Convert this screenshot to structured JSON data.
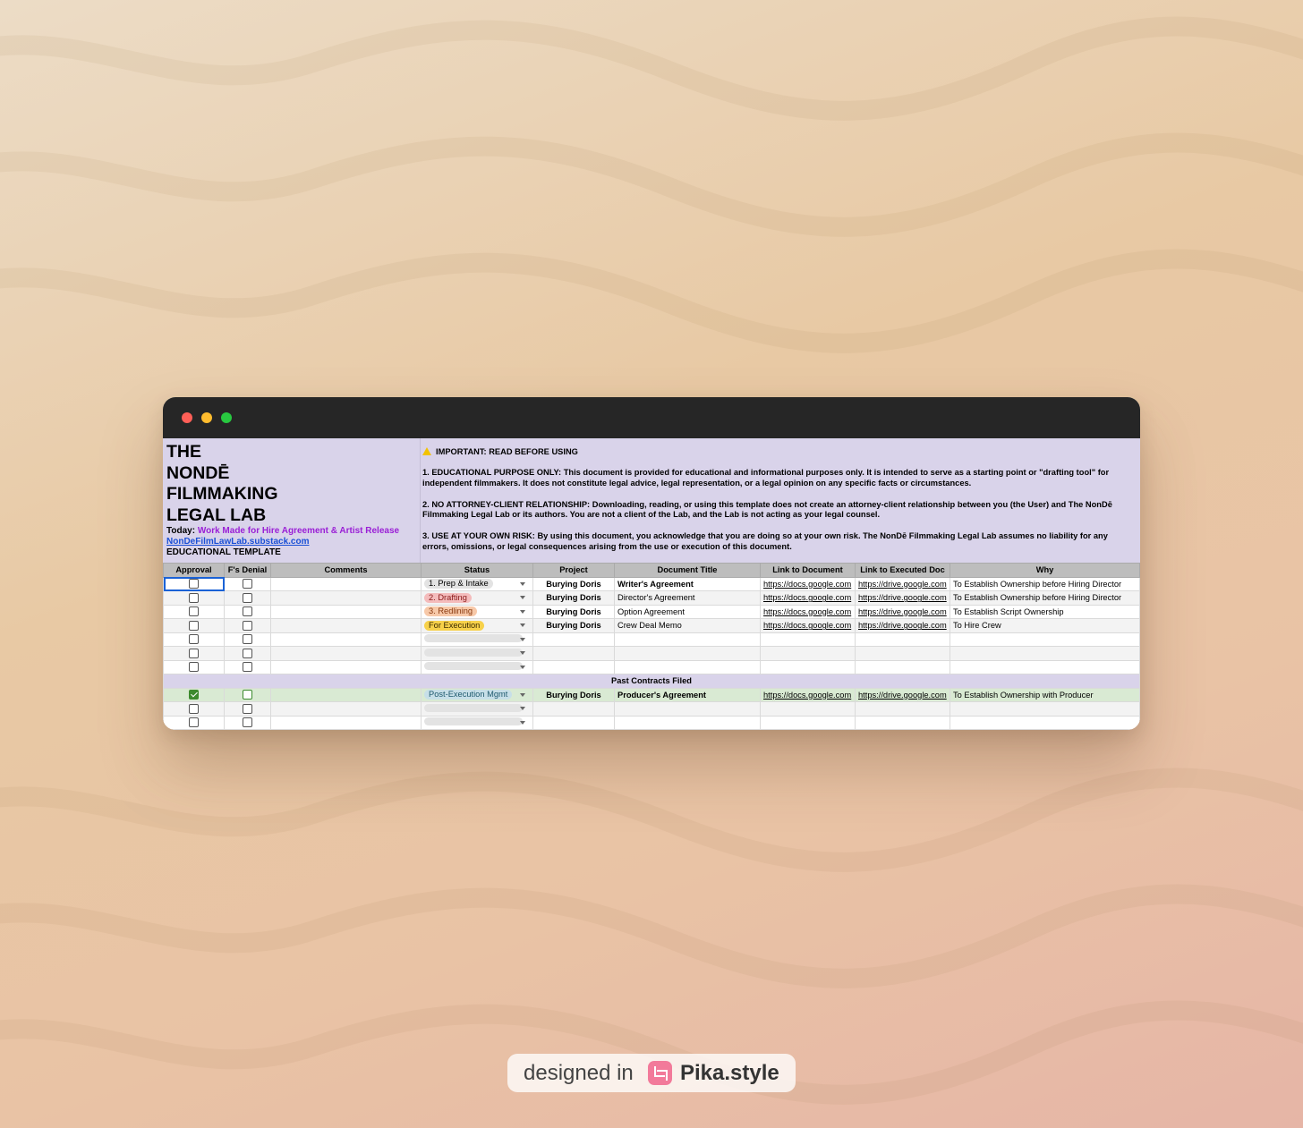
{
  "sidebar_header": {
    "brand_lines": [
      "THE",
      "NONDĒ",
      "FILMMAKING",
      "LEGAL LAB"
    ],
    "today_label": "Today:",
    "today_value": "Work Made for Hire Agreement & Artist Release",
    "site_link": "NonDeFilmLawLab.substack.com",
    "template_label": "EDUCATIONAL TEMPLATE"
  },
  "notice": {
    "title": "IMPORTANT: READ BEFORE USING",
    "p1": "1. EDUCATIONAL PURPOSE ONLY: This document is provided for educational and informational purposes only. It is intended to serve as a starting point or \"drafting tool\" for independent filmmakers. It does not constitute legal advice, legal representation, or a legal opinion on any specific facts or circumstances.",
    "p2": "2. NO ATTORNEY-CLIENT RELATIONSHIP: Downloading, reading, or using this template does not create an attorney-client relationship between you (the User) and The NonDē Filmmaking Legal Lab or its authors. You are not a client of the Lab, and the Lab is not acting as your legal counsel.",
    "p3": "3. USE AT YOUR OWN RISK: By using this document, you acknowledge that you are doing so at your own risk. The NonDē Filmmaking Legal Lab assumes no liability for any errors, omissions, or legal consequences arising from the use or execution of this document."
  },
  "columns": [
    "Approval",
    "F's Denial",
    "Comments",
    "Status",
    "Project",
    "Document Title",
    "Link to Document",
    "Link to Executed Doc",
    "Why"
  ],
  "rows": [
    {
      "status": "1. Prep & Intake",
      "project": "Burying Doris",
      "title": "Writer's Agreement",
      "link": "https://docs.google.com",
      "exec": "https://drive.google.com",
      "why": "To Establish Ownership before Hiring Director"
    },
    {
      "status": "2. Drafting",
      "project": "Burying Doris",
      "title": "Director's Agreement",
      "link": "https://docs.google.com",
      "exec": "https://drive.google.com",
      "why": "To Establish Ownership before Hiring Director"
    },
    {
      "status": "3. Redlining",
      "project": "Burying Doris",
      "title": "Option Agreement",
      "link": "https://docs.google.com",
      "exec": "https://drive.google.com",
      "why": "To Establish Script Ownership"
    },
    {
      "status": "For Execution",
      "project": "Burying Doris",
      "title": "Crew Deal Memo",
      "link": "https://docs.google.com",
      "exec": "https://drive.google.com",
      "why": "To Hire Crew"
    }
  ],
  "section_label": "Past Contracts Filed",
  "past_row": {
    "status": "Post-Execution Mgmt",
    "project": "Burying Doris",
    "title": "Producer's Agreement",
    "link": "https://docs.google.com",
    "exec": "https://drive.google.com",
    "why": "To Establish Ownership with Producer",
    "approved": true
  },
  "colors": {
    "header_purple": "#d9d3ea",
    "past_green": "#d9ead3",
    "today_purple": "#9a1fd6"
  },
  "badge": {
    "prefix": "designed in",
    "brand": "Pika.style"
  }
}
